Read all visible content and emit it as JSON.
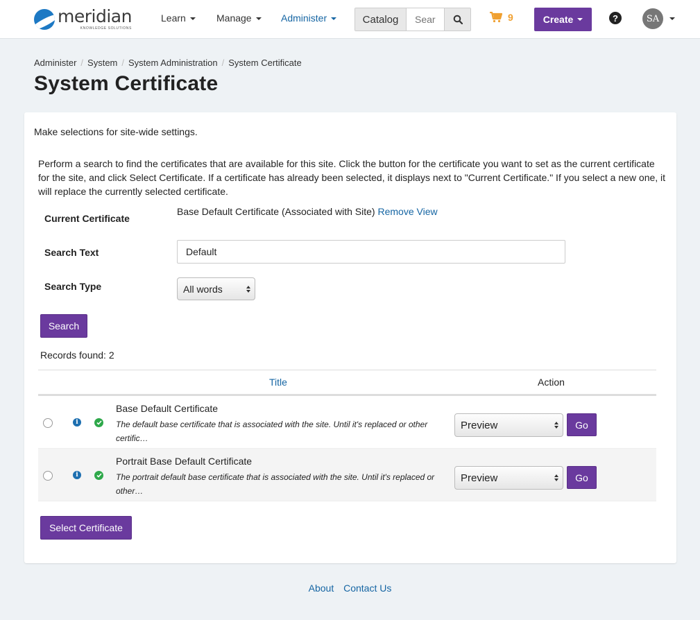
{
  "header": {
    "logo_word": "meridian",
    "logo_sub": "KNOWLEDGE SOLUTIONS",
    "nav": [
      {
        "label": "Learn"
      },
      {
        "label": "Manage"
      },
      {
        "label": "Administer"
      }
    ],
    "catalog_label": "Catalog",
    "search_placeholder": "Sear",
    "cart_count": "9",
    "create_label": "Create",
    "help_label": "?",
    "avatar_initials": "SA"
  },
  "breadcrumb": [
    "Administer",
    "System",
    "System Administration",
    "System Certificate"
  ],
  "page_title": "System Certificate",
  "intro": "Make selections for site-wide settings.",
  "description": "Perform a search to find the certificates that are available for this site. Click the button for the certificate you want to set as the current certificate for the site, and click Select Certificate. If a certificate has already been selected, it displays next to \"Current Certificate.\" If you select a new one, it will replace the currently selected certificate.",
  "form": {
    "current_label": "Current Certificate",
    "current_value": "Base Default Certificate (Associated with Site)",
    "remove_link": "Remove",
    "view_link": "View",
    "search_text_label": "Search Text",
    "search_text_value": "Default",
    "search_type_label": "Search Type",
    "search_type_value": "All words",
    "search_button": "Search"
  },
  "records_found": "Records found: 2",
  "table": {
    "col_title": "Title",
    "col_action": "Action",
    "rows": [
      {
        "title": "Base Default Certificate",
        "description": "The default base certificate that is associated with the site. Until it's replaced or other certific…",
        "action": "Preview",
        "go": "Go"
      },
      {
        "title": "Portrait Base Default Certificate",
        "description": "The portrait default base certificate that is associated with the site. Until it's replaced or other…",
        "action": "Preview",
        "go": "Go"
      }
    ]
  },
  "select_certificate_button": "Select Certificate",
  "footer": {
    "about": "About",
    "contact": "Contact Us"
  },
  "colors": {
    "brand_purple": "#6a3a9e",
    "link_blue": "#1565a3",
    "cart_orange": "#f0a030"
  }
}
